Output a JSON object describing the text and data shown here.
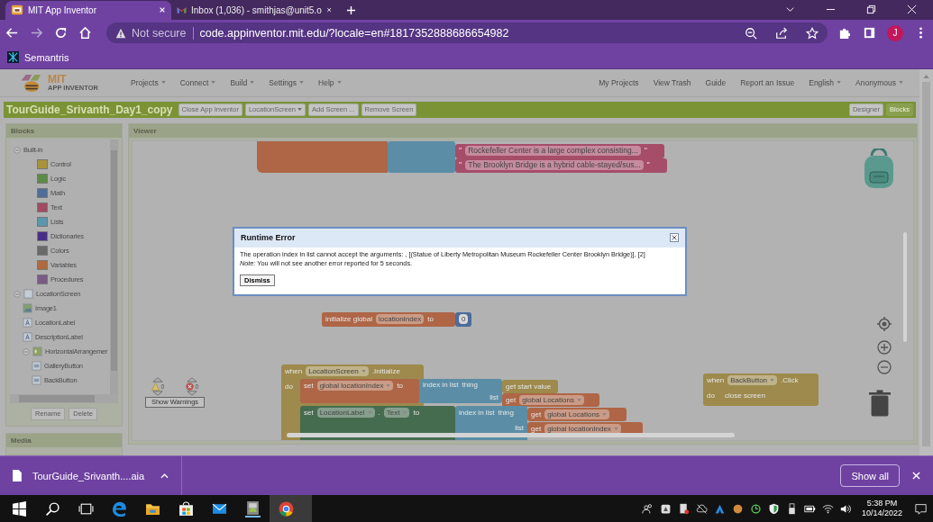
{
  "browser": {
    "tabs": [
      {
        "title": "MIT App Inventor",
        "selected": true
      },
      {
        "title": "Inbox (1,036) - smithjas@unit5.o",
        "selected": false
      }
    ],
    "security": "Not secure",
    "url": "code.appinventor.mit.edu/?locale=en#1817352888686654982",
    "profile": "J",
    "bookmarks": [
      "Semantris"
    ]
  },
  "app": {
    "logo_title": "MIT",
    "logo_subtitle": "APP INVENTOR",
    "menu": [
      {
        "label": "Projects",
        "dropdown": true
      },
      {
        "label": "Connect",
        "dropdown": true
      },
      {
        "label": "Build",
        "dropdown": true
      },
      {
        "label": "Settings",
        "dropdown": true
      },
      {
        "label": "Help",
        "dropdown": true
      }
    ],
    "user_menu": [
      {
        "label": "My Projects",
        "dropdown": false
      },
      {
        "label": "View Trash",
        "dropdown": false
      },
      {
        "label": "Guide",
        "dropdown": false
      },
      {
        "label": "Report an Issue",
        "dropdown": false
      },
      {
        "label": "English",
        "dropdown": true
      },
      {
        "label": "Anonymous",
        "dropdown": true
      }
    ]
  },
  "project": {
    "name": "TourGuide_Srivanth_Day1_copy",
    "buttons": [
      {
        "label": "Close App Inventor",
        "dropdown": false
      },
      {
        "label": "LocationScreen",
        "dropdown": true
      },
      {
        "label": "Add Screen ...",
        "dropdown": false
      },
      {
        "label": "Remove Screen",
        "dropdown": false
      }
    ],
    "views": [
      {
        "label": "Designer",
        "selected": false
      },
      {
        "label": "Blocks",
        "selected": true
      }
    ]
  },
  "blocks_panel": {
    "title": "Blocks",
    "tree": [
      {
        "label": "Built-in",
        "kind": "folder",
        "expanded": true,
        "children": [
          {
            "label": "Control",
            "kind": "drawer",
            "color": "#a8923c"
          },
          {
            "label": "Logic",
            "kind": "drawer",
            "color": "#5e8a48"
          },
          {
            "label": "Math",
            "kind": "drawer",
            "color": "#4f6e98"
          },
          {
            "label": "Text",
            "kind": "drawer",
            "color": "#a04a64"
          },
          {
            "label": "Lists",
            "kind": "drawer",
            "color": "#5a96ae"
          },
          {
            "label": "Dictionaries",
            "kind": "drawer",
            "color": "#4a2f88"
          },
          {
            "label": "Colors",
            "kind": "drawer",
            "color": "#6a6a6a"
          },
          {
            "label": "Variables",
            "kind": "drawer",
            "color": "#b06a3e"
          },
          {
            "label": "Procedures",
            "kind": "drawer",
            "color": "#7c5a86"
          }
        ]
      },
      {
        "label": "LocationScreen",
        "kind": "screen",
        "expanded": true,
        "children": [
          {
            "label": "Image1",
            "kind": "image"
          },
          {
            "label": "LocationLabel",
            "kind": "label"
          },
          {
            "label": "DescriptionLabel",
            "kind": "label"
          },
          {
            "label": "HorizontalArrangemer",
            "kind": "arrangement",
            "expanded": true,
            "children": [
              {
                "label": "GalleryButton",
                "kind": "button"
              },
              {
                "label": "BackButton",
                "kind": "button"
              }
            ]
          }
        ]
      }
    ],
    "buttons": [
      {
        "label": "Rename",
        "disabled": true
      },
      {
        "label": "Delete",
        "disabled": true
      }
    ]
  },
  "media_panel": {
    "title": "Media"
  },
  "viewer": {
    "title": "Viewer",
    "blocks": [
      {
        "kind": "init"
      },
      {
        "kind": "call"
      },
      {
        "kind": "text",
        "rows": [
          [
            {
              "kind": "label",
              "text": "\""
            },
            {
              "kind": "field",
              "text": "Rockefeller Center is a large complex consisting..."
            },
            {
              "kind": "label",
              "text": "\""
            }
          ]
        ]
      },
      {
        "kind": "text",
        "rows": [
          [
            {
              "kind": "label",
              "text": "\""
            },
            {
              "kind": "field",
              "text": "The Brooklyn Bridge is a hybrid cable-stayed/sus..."
            },
            {
              "kind": "label",
              "text": "\""
            }
          ]
        ]
      },
      {
        "kind": "init",
        "rows": [
          [
            {
              "kind": "label",
              "text": "initialize global"
            },
            {
              "kind": "field",
              "text": "locationIndex"
            },
            {
              "kind": "label",
              "text": "to"
            }
          ]
        ]
      },
      {
        "kind": "number",
        "rows": [
          [
            {
              "kind": "field",
              "text": "0"
            }
          ]
        ]
      },
      {
        "kind": "event",
        "rows": [
          [
            {
              "kind": "label",
              "text": "when"
            },
            {
              "kind": "dropdown",
              "text": "LocationScreen"
            },
            {
              "kind": "label",
              "text": ".Initialize"
            }
          ],
          [
            {
              "kind": "label",
              "text": "do"
            }
          ]
        ]
      },
      {
        "kind": "set",
        "rows": [
          [
            {
              "kind": "label",
              "text": "set"
            },
            {
              "kind": "dropdown",
              "text": "global locationIndex"
            },
            {
              "kind": "label",
              "text": "to"
            }
          ]
        ]
      },
      {
        "kind": "call",
        "rows": [
          [
            {
              "kind": "label",
              "text": "index in list"
            },
            {
              "kind": "label",
              "text": "thing"
            }
          ],
          [
            {
              "kind": "label",
              "text": "list"
            }
          ]
        ]
      },
      {
        "kind": "control",
        "rows": [
          [
            {
              "kind": "label",
              "text": "get start value"
            }
          ]
        ]
      },
      {
        "kind": "get",
        "rows": [
          [
            {
              "kind": "label",
              "text": "get"
            },
            {
              "kind": "dropdown",
              "text": "global Locations"
            }
          ]
        ]
      },
      {
        "kind": "component",
        "rows": [
          [
            {
              "kind": "label",
              "text": "set"
            },
            {
              "kind": "dropdown",
              "text": "LocationLabel"
            },
            {
              "kind": "label",
              "text": "."
            },
            {
              "kind": "dropdown",
              "text": "Text"
            },
            {
              "kind": "label",
              "text": "to"
            }
          ]
        ]
      },
      {
        "kind": "call",
        "rows": [
          [
            {
              "kind": "label",
              "text": "index in list"
            },
            {
              "kind": "label",
              "text": "thing"
            }
          ],
          [
            {
              "kind": "label",
              "text": "list"
            }
          ]
        ]
      },
      {
        "kind": "get",
        "rows": [
          [
            {
              "kind": "label",
              "text": "get"
            },
            {
              "kind": "dropdown",
              "text": "global Locations"
            }
          ]
        ]
      },
      {
        "kind": "get",
        "rows": [
          [
            {
              "kind": "label",
              "text": "get"
            },
            {
              "kind": "dropdown",
              "text": "global locationIndex"
            }
          ]
        ]
      },
      {
        "kind": "event",
        "rows": [
          [
            {
              "kind": "label",
              "text": "when"
            },
            {
              "kind": "dropdown",
              "text": "BackButton"
            },
            {
              "kind": "label",
              "text": ".Click"
            }
          ],
          [
            {
              "kind": "label",
              "text": "do"
            }
          ]
        ]
      },
      {
        "kind": "control",
        "rows": [
          [
            {
              "kind": "label",
              "text": "close screen"
            }
          ]
        ]
      }
    ],
    "warnings": "0",
    "errors": "0",
    "warnings_button": "Show Warnings"
  },
  "dialog": {
    "title": "Runtime Error",
    "message": "The operation index in list cannot accept the arguments: , [(Statue of Liberty Metropolitan Museum Rockefeller Center Brooklyn Bridge)], [2]",
    "note": "*Note:* You will not see another error reported for 5 seconds.",
    "button": "Dismiss"
  },
  "downloads": {
    "file": "TourGuide_Srivanth....aia",
    "button": "Show all"
  },
  "taskbar": {
    "time": "5:38 PM",
    "date": "10/14/2022"
  }
}
